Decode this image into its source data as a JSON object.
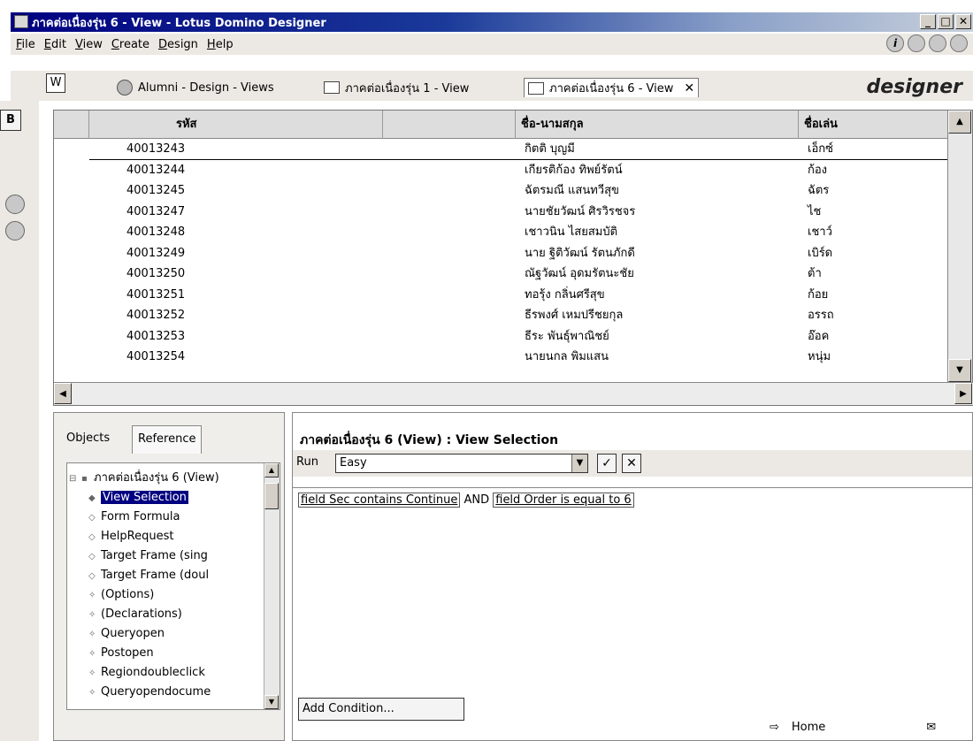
{
  "window": {
    "title": "ภาคต่อเนื่องรุ่น 6 - View - Lotus Domino Designer",
    "min": "_",
    "max": "□",
    "close": "✕"
  },
  "menu": [
    "File",
    "Edit",
    "View",
    "Create",
    "Design",
    "Help"
  ],
  "tabs": {
    "home_icon": "W",
    "items": [
      {
        "label": "Alumni - Design - Views",
        "icon": "globe-icon"
      },
      {
        "label": "ภาคต่อเนื่องรุ่น 1 - View",
        "icon": "page-icon"
      },
      {
        "label": "ภาคต่อเนื่องรุ่น 6 - View",
        "icon": "page-icon",
        "active": true,
        "close": "✕"
      }
    ]
  },
  "brand": "designer",
  "left_strip": {
    "bookmark": "B"
  },
  "view": {
    "headers": [
      "รหัส",
      "ชื่อ-นามสกุล",
      "ชื่อเล่น"
    ],
    "rows": [
      {
        "id": "40013243",
        "name": "กิตติ บุญมี",
        "nick": "เอ็กซ์"
      },
      {
        "id": "40013244",
        "name": "เกียรติก้อง ทิพย์รัตน์",
        "nick": "ก้อง"
      },
      {
        "id": "40013245",
        "name": "ฉัตรมณี แสนทวีสุข",
        "nick": "ฉัตร"
      },
      {
        "id": "40013247",
        "name": "นายชัยวัฒน์ ศิรวิรชจร",
        "nick": "ไช"
      },
      {
        "id": "40013248",
        "name": "เชาวนิน ไสยสมบัติ",
        "nick": "เชาว์"
      },
      {
        "id": "40013249",
        "name": "นาย ฐิติวัฒน์ รัตนภักดี",
        "nick": "เบิร์ด"
      },
      {
        "id": "40013250",
        "name": "ณัฐวัฒน์ อุดมรัตนะชัย",
        "nick": "ต้า"
      },
      {
        "id": "40013251",
        "name": "ทอรุ้ง กลิ่นศรีสุข",
        "nick": "ก้อย"
      },
      {
        "id": "40013252",
        "name": "ธีรพงศ์ เหมปรีชยกุล",
        "nick": "อรรถ"
      },
      {
        "id": "40013253",
        "name": "ธีระ พันธุ์พาณิชย์",
        "nick": "อ๊อค"
      },
      {
        "id": "40013254",
        "name": "นายนกล พิมแสน",
        "nick": "หนุ่ม"
      }
    ]
  },
  "objects": {
    "tab_objects": "Objects",
    "tab_reference": "Reference",
    "root": "ภาคต่อเนื่องรุ่น 6 (View)",
    "items": [
      "View Selection",
      "Form Formula",
      "HelpRequest",
      "Target Frame (sing",
      "Target Frame (doul",
      "(Options)",
      "(Declarations)",
      "Queryopen",
      "Postopen",
      "Regiondoubleclick",
      "Queryopendocume"
    ]
  },
  "editor": {
    "title": "ภาคต่อเนื่องรุ่น 6 (View) : View Selection",
    "run_label": "Run",
    "run_value": "Easy",
    "check": "✓",
    "cancel": "✕",
    "cond1": "field Sec contains Continue",
    "and": "AND",
    "cond2": "field Order is equal to 6",
    "add_condition": "Add Condition..."
  },
  "status": {
    "home": "Home"
  }
}
